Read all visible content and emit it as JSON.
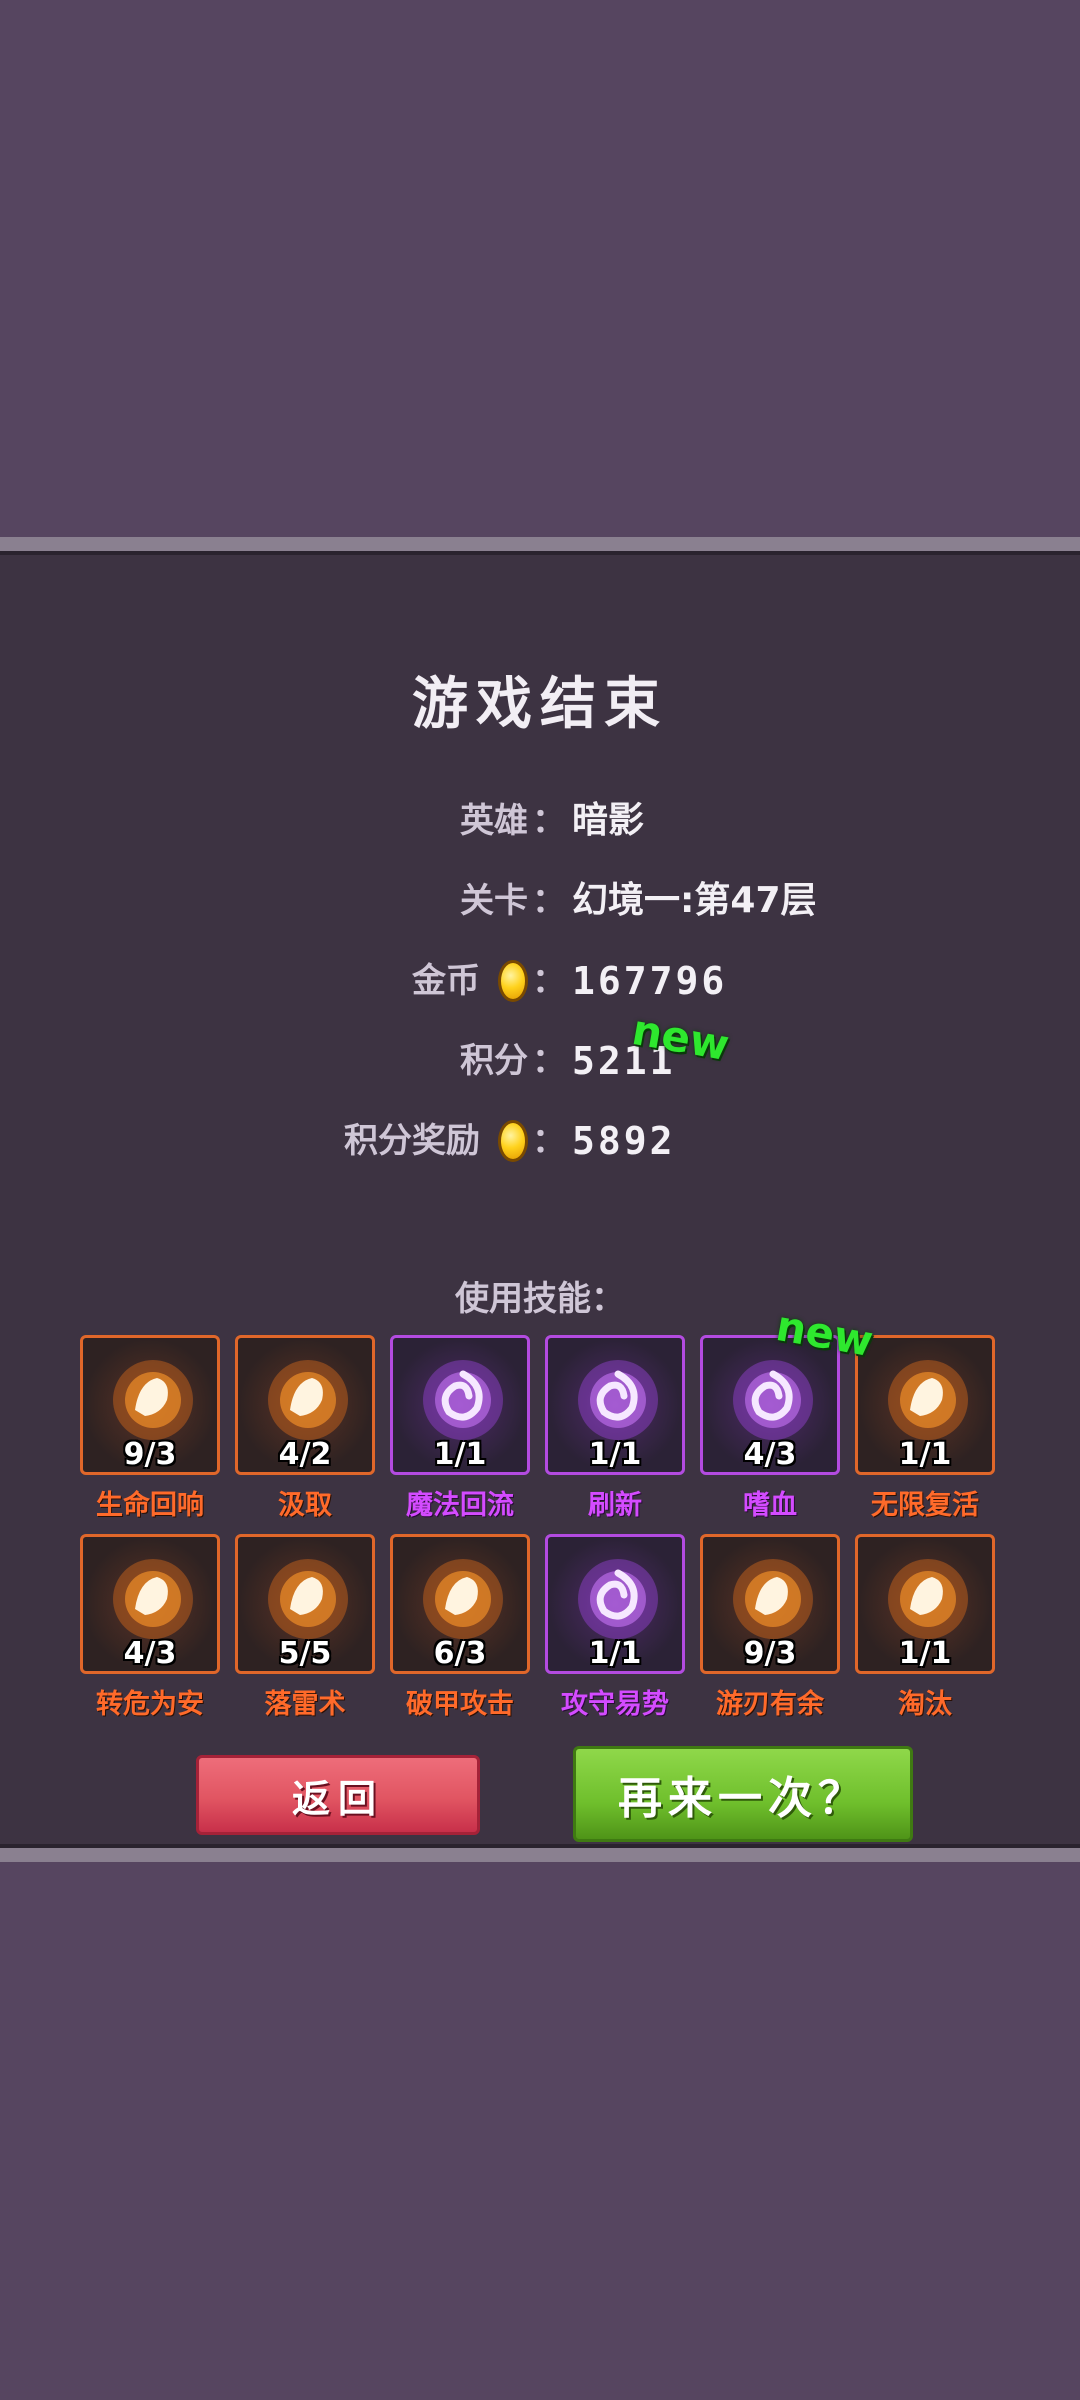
{
  "title": "游戏结束",
  "stats": {
    "hero": {
      "label": "英雄",
      "value": "暗影"
    },
    "stage": {
      "label": "关卡",
      "value": "幻境一:第47层"
    },
    "gold": {
      "label": "金币",
      "value": "167796"
    },
    "score": {
      "label": "积分",
      "value": "5211",
      "badge": "new"
    },
    "reward": {
      "label": "积分奖励",
      "value": "5892"
    }
  },
  "colon": "：",
  "skills_title": "使用技能：",
  "skills": [
    {
      "name": "生命回响",
      "count": "9/3",
      "tier": "orange",
      "icon": "muscle-arm-icon"
    },
    {
      "name": "汲取",
      "count": "4/2",
      "tier": "orange",
      "icon": "drain-plus-icon"
    },
    {
      "name": "魔法回流",
      "count": "1/1",
      "tier": "purple",
      "icon": "magic-crystal-icon"
    },
    {
      "name": "刷新",
      "count": "1/1",
      "tier": "purple",
      "icon": "swirl-icon"
    },
    {
      "name": "嗜血",
      "count": "4/3",
      "tier": "purple",
      "icon": "bloodlust-icon",
      "badge": "new"
    },
    {
      "name": "无限复活",
      "count": "1/1",
      "tier": "orange",
      "icon": "revive-cross-icon"
    },
    {
      "name": "转危为安",
      "count": "4/3",
      "tier": "orange",
      "icon": "heal-burst-icon"
    },
    {
      "name": "落雷术",
      "count": "5/5",
      "tier": "orange",
      "icon": "lightning-skull-icon"
    },
    {
      "name": "破甲攻击",
      "count": "6/3",
      "tier": "orange",
      "icon": "armor-break-icon"
    },
    {
      "name": "攻守易势",
      "count": "1/1",
      "tier": "purple",
      "icon": "shield-swap-icon"
    },
    {
      "name": "游刃有余",
      "count": "9/3",
      "tier": "orange",
      "icon": "blade-swirl-icon"
    },
    {
      "name": "淘汰",
      "count": "1/1",
      "tier": "orange",
      "icon": "slash-icon"
    }
  ],
  "buttons": {
    "back": "返回",
    "retry": "再来一次？"
  },
  "colors": {
    "orange_skill": "#ff6a2a",
    "purple_skill": "#d44bff",
    "new_badge": "#2ee82e"
  }
}
